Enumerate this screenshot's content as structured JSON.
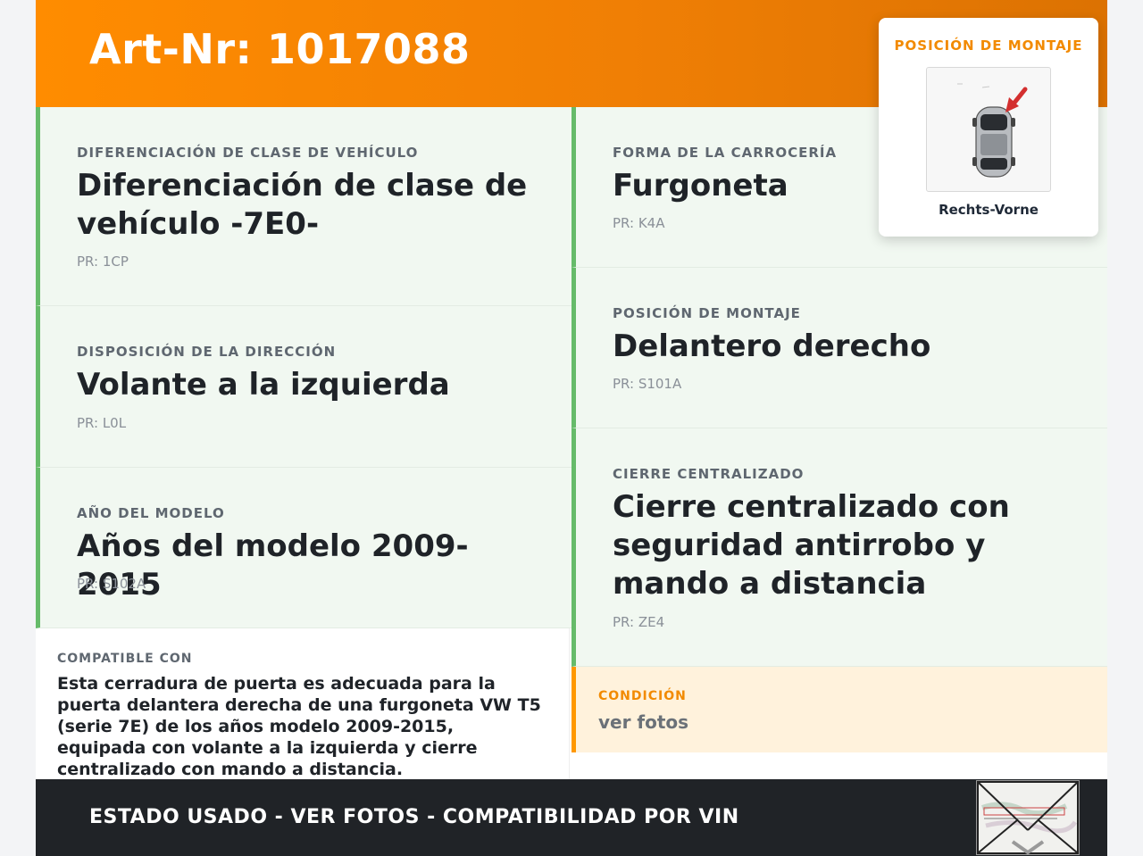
{
  "header": {
    "title": "Art-Nr: 1017088"
  },
  "mount_card": {
    "title": "POSICIÓN DE MONTAJE",
    "image_icon": "car-top-view-front-right-arrow-icon",
    "label": "Rechts-Vorne"
  },
  "left_attributes": [
    {
      "label": "DIFERENCIACIÓN DE CLASE DE VEHÍCULO",
      "value": "Diferenciación de clase de vehículo -7E0-",
      "pr": "PR: 1CP"
    },
    {
      "label": "DISPOSICIÓN DE LA DIRECCIÓN",
      "value": "Volante a la izquierda",
      "pr": "PR: L0L"
    },
    {
      "label": "AÑO DEL MODELO",
      "value": "Años del modelo 2009-2015",
      "pr": "PR: S102A"
    }
  ],
  "right_attributes": [
    {
      "label": "FORMA DE LA CARROCERÍA",
      "value": "Furgoneta",
      "pr": "PR: K4A"
    },
    {
      "label": "POSICIÓN DE MONTAJE",
      "value": "Delantero derecho",
      "pr": "PR: S101A"
    },
    {
      "label": "CIERRE CENTRALIZADO",
      "value": "Cierre centralizado con seguridad antirrobo y mando a distancia",
      "pr": "PR: ZE4"
    }
  ],
  "compatible": {
    "label": "COMPATIBLE CON",
    "text": "Esta cerradura de puerta es adecuada para la puerta delantera derecha de una furgoneta VW T5 (serie 7E) de los años modelo 2009-2015, equipada con volante a la izquierda y cierre centralizado con mando a distancia."
  },
  "condition": {
    "label": "CONDICIÓN",
    "value": "ver fotos"
  },
  "footer": {
    "text": "ESTADO USADO - VER FOTOS - COMPATIBILIDAD POR VIN",
    "image_icon": "registration-document-envelope-icon"
  },
  "colors": {
    "header_orange": "#ff8c00",
    "accent_green": "#66bb6a",
    "attr_bg": "#f1f8f1",
    "condition_bg": "#fff2dc",
    "condition_accent": "#ff9800",
    "footer_bg": "#202327"
  }
}
